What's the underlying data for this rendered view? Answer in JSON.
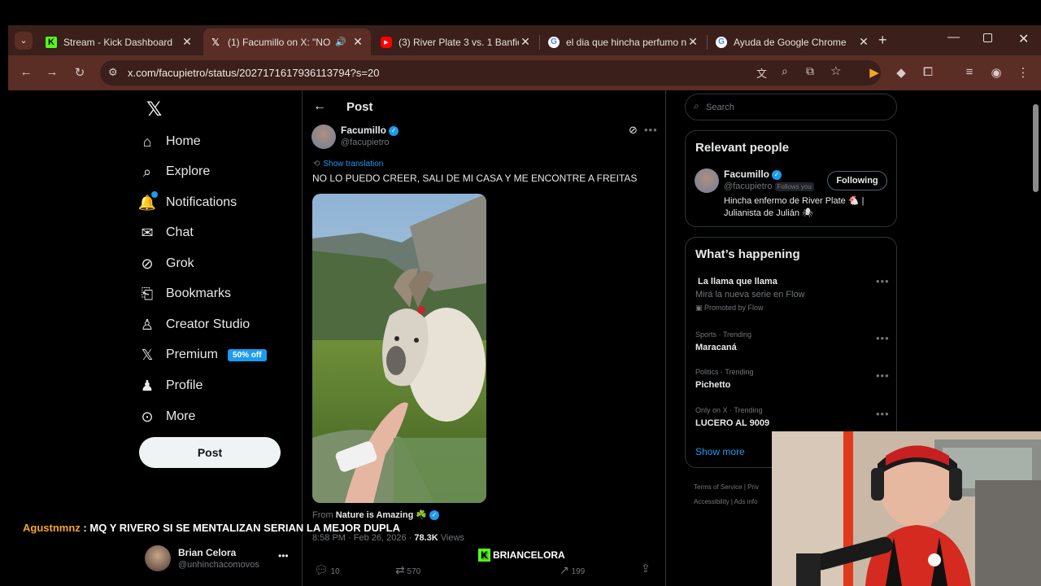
{
  "browser": {
    "tabs": [
      {
        "title": "Stream - Kick Dashboard",
        "icon": "kick-icon",
        "close": "✕"
      },
      {
        "title": "(1) Facumillo on X: \"NO",
        "icon": "x-logo-icon",
        "close": "✕",
        "active": true
      },
      {
        "title": "(3) River Plate 3 vs. 1 Banfiel",
        "icon": "youtube-icon",
        "close": "✕"
      },
      {
        "title": "el dia que hincha perfumo n",
        "icon": "google-icon",
        "close": "✕"
      },
      {
        "title": "Ayuda de Google Chrome",
        "icon": "google-icon",
        "close": "✕"
      }
    ],
    "new_tab": "+",
    "url": "x.com/facupietro/status/2027171617936113794?s=20"
  },
  "nav": {
    "items": [
      {
        "label": "Home",
        "icon": "home-icon"
      },
      {
        "label": "Explore",
        "icon": "search-icon"
      },
      {
        "label": "Notifications",
        "icon": "bell-icon"
      },
      {
        "label": "Chat",
        "icon": "mail-icon"
      },
      {
        "label": "Grok",
        "icon": "grok-icon"
      },
      {
        "label": "Bookmarks",
        "icon": "bookmark-icon"
      },
      {
        "label": "Creator Studio",
        "icon": "creator-icon"
      },
      {
        "label": "Premium",
        "icon": "x-logo-icon"
      },
      {
        "label": "Profile",
        "icon": "person-icon"
      },
      {
        "label": "More",
        "icon": "more-circle-icon"
      }
    ],
    "premium_badge": "50% off",
    "post_button": "Post",
    "account": {
      "name": "Brian Celora",
      "handle": "@unhinchacomovos"
    }
  },
  "post": {
    "header": "Post",
    "author_name": "Facumillo",
    "author_handle": "@facupietro",
    "show_translation": "Show translation",
    "text": "NO LO PUEDO CREER, SALI DE MI CASA Y ME ENCONTRE A FREITAS",
    "from_prefix": "From",
    "from_source": "Nature is Amazing ☘️",
    "meta_time": "8:58 PM · Feb 26, 2026 ·",
    "meta_views": "78.3K",
    "meta_views_label": "Views",
    "actions": {
      "replies": "10",
      "reposts": "570",
      "views": "199"
    }
  },
  "search": {
    "placeholder": "Search"
  },
  "relevant_people": {
    "title": "Relevant people",
    "name": "Facumillo",
    "handle": "@facupietro",
    "follows_you": "Follows you",
    "button": "Following",
    "bio": "Hincha enfermo de River Plate 🐔 | Julianista de Julián 🕷"
  },
  "happening": {
    "title": "What’s happening",
    "items": [
      {
        "title": "La llama que llama",
        "sub": "Mirá la nueva serie en Flow",
        "promo": "Promoted by Flow"
      },
      {
        "context": "Sports · Trending",
        "title": "Maracaná"
      },
      {
        "context": "Politics · Trending",
        "title": "Pichetto"
      },
      {
        "context": "Only on X · Trending",
        "title": "LUCERO AL 9009"
      }
    ],
    "show_more": "Show more"
  },
  "footer": {
    "links": [
      "Terms of Service",
      "|",
      "Priv",
      "Accessibility",
      "|",
      "Ads info"
    ]
  },
  "stream_overlay": {
    "chat_user": "Agustnmnz",
    "chat_sep": ":",
    "chat_message": "MQ Y RIVERO SI SE MENTALIZAN SERIAN LA MEJOR DUPLA",
    "channel": "BRIANCELORA"
  },
  "colors": {
    "accent": "#1d9bf0",
    "tabbar": "#3a1f1a",
    "toolbar": "#5a2e25",
    "kick": "#53fc18",
    "chat_user": "#f5a623"
  }
}
